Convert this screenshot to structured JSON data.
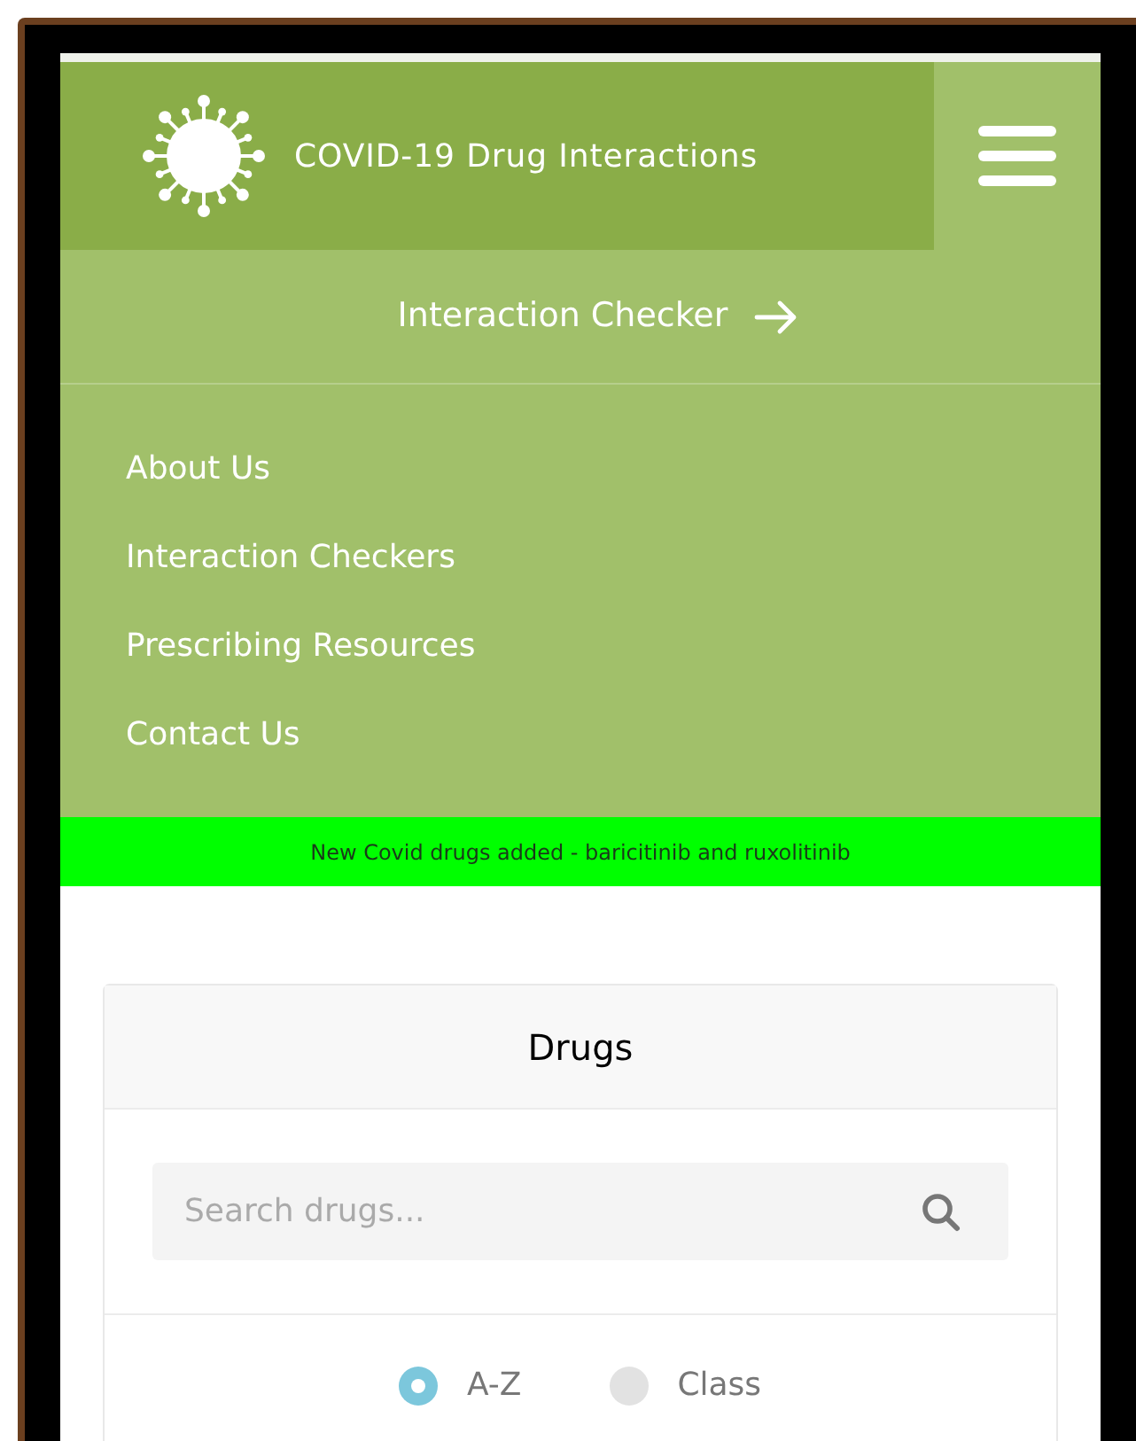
{
  "header": {
    "title": "COVID-19 Drug Interactions",
    "menu_expanded": true
  },
  "cta": {
    "label": "Interaction Checker"
  },
  "menu": {
    "items": [
      {
        "label": "About Us"
      },
      {
        "label": "Interaction Checkers"
      },
      {
        "label": "Prescribing Resources"
      },
      {
        "label": "Contact Us"
      }
    ]
  },
  "banner": {
    "text": "New Covid drugs added - baricitinib and ruxolitinib"
  },
  "card": {
    "title": "Drugs",
    "search": {
      "placeholder": "Search drugs..."
    },
    "options": [
      {
        "label": "A-Z",
        "selected": true
      },
      {
        "label": "Class",
        "selected": false
      }
    ]
  }
}
